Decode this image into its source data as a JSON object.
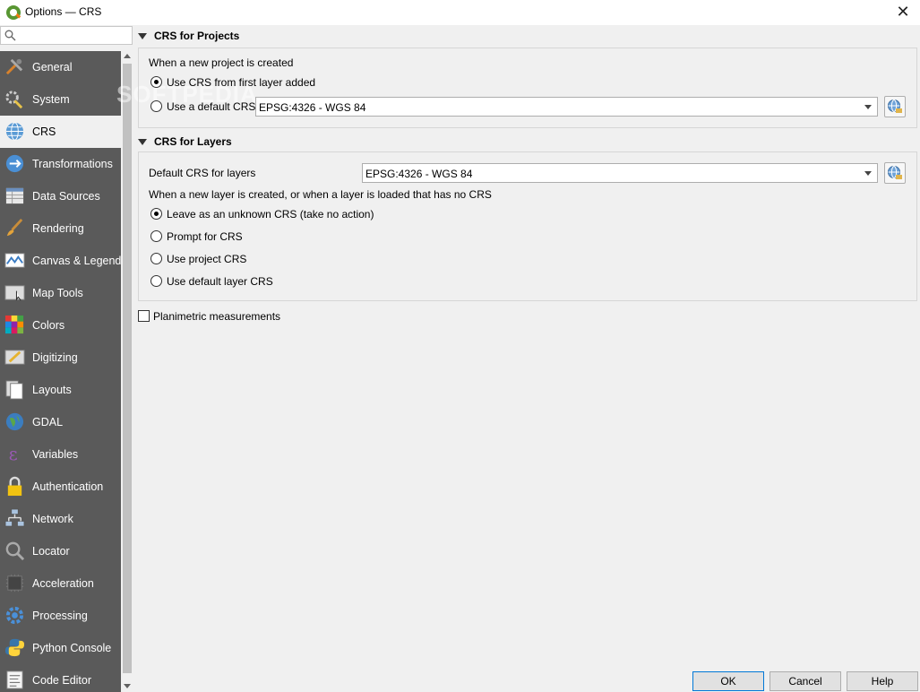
{
  "window": {
    "title": "Options — CRS"
  },
  "search": {
    "placeholder": ""
  },
  "sidebar": {
    "items": [
      {
        "label": "General",
        "icon": "general-icon"
      },
      {
        "label": "System",
        "icon": "system-icon"
      },
      {
        "label": "CRS",
        "icon": "crs-globe-icon",
        "selected": true
      },
      {
        "label": "Transformations",
        "icon": "transformations-icon"
      },
      {
        "label": "Data Sources",
        "icon": "data-sources-icon"
      },
      {
        "label": "Rendering",
        "icon": "rendering-brush-icon"
      },
      {
        "label": "Canvas & Legend",
        "icon": "canvas-legend-icon"
      },
      {
        "label": "Map Tools",
        "icon": "map-tools-icon"
      },
      {
        "label": "Colors",
        "icon": "colors-icon"
      },
      {
        "label": "Digitizing",
        "icon": "digitizing-icon"
      },
      {
        "label": "Layouts",
        "icon": "layouts-icon"
      },
      {
        "label": "GDAL",
        "icon": "gdal-icon"
      },
      {
        "label": "Variables",
        "icon": "variables-icon"
      },
      {
        "label": "Authentication",
        "icon": "lock-icon"
      },
      {
        "label": "Network",
        "icon": "network-icon"
      },
      {
        "label": "Locator",
        "icon": "locator-search-icon"
      },
      {
        "label": "Acceleration",
        "icon": "acceleration-icon"
      },
      {
        "label": "Processing",
        "icon": "processing-gear-icon"
      },
      {
        "label": "Python Console",
        "icon": "python-icon"
      },
      {
        "label": "Code Editor",
        "icon": "code-editor-icon"
      }
    ]
  },
  "projects": {
    "header": "CRS for Projects",
    "intro": "When a new project is created",
    "option_first_layer": "Use CRS from first layer added",
    "option_default": "Use a default CRS",
    "default_crs": "EPSG:4326 - WGS 84"
  },
  "layers": {
    "header": "CRS for Layers",
    "default_label": "Default CRS for layers",
    "default_crs": "EPSG:4326 - WGS 84",
    "intro": "When a new layer is created, or when a layer is loaded that has no CRS",
    "options": [
      "Leave as an unknown CRS (take no action)",
      "Prompt for CRS",
      "Use project CRS",
      "Use default layer CRS"
    ]
  },
  "planimetric": {
    "label": "Planimetric measurements",
    "checked": false
  },
  "buttons": {
    "ok": "OK",
    "cancel": "Cancel",
    "help": "Help"
  },
  "watermark": "SOFTPEDIA"
}
